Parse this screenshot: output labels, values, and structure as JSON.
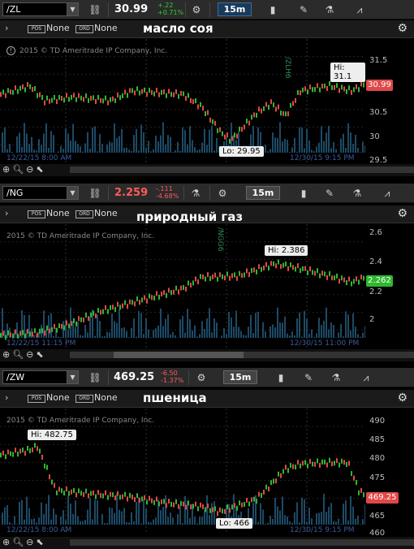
{
  "panels": [
    {
      "symbol": "/ZL",
      "price": "30.99",
      "price_color": "#ffffff",
      "chg1": "+.22",
      "chg2": "+0.71%",
      "chg_color": "#33cc33",
      "aggregation": "15m",
      "agg_blue": true,
      "pos_label": "POS",
      "pos_value": "None",
      "ord_label": "ORD",
      "ord_value": "None",
      "title": "масло соя",
      "copyright": "2015 © TD Ameritrade IP Company, Inc.",
      "ticks": [
        "31.5",
        "31",
        "30.5",
        "30",
        "29.5"
      ],
      "last_price": "30.99",
      "last_color": "#e04848",
      "hi": "Hi: 31.1",
      "lo": "Lo: 29.95",
      "date_left": "12/22/15 8:00 AM",
      "date_right": "12/30/15 9:15 PM",
      "contract": "/ZLH6"
    },
    {
      "symbol": "/NG",
      "price": "2.259",
      "price_color": "#ff5a5a",
      "chg1": "-.111",
      "chg2": "-4.68%",
      "chg_color": "#ff5a5a",
      "aggregation": "15m",
      "agg_blue": false,
      "pos_label": "POS",
      "pos_value": "None",
      "ord_label": "ORD",
      "ord_value": "None",
      "title": "природный газ",
      "copyright": "2015 © TD Ameritrade IP Company, Inc.",
      "ticks": [
        "2.6",
        "2.4",
        "2.2",
        "2"
      ],
      "last_price": "2.262",
      "last_color": "#2eb82e",
      "hi": "Hi: 2.386",
      "date_left": "12/22/15 11:15 PM",
      "date_right": "12/30/15 11:00 PM",
      "contract": "/NGG6"
    },
    {
      "symbol": "/ZW",
      "price": "469.25",
      "price_color": "#ffffff",
      "chg1": "-6.50",
      "chg2": "-1.37%",
      "chg_color": "#ff5a5a",
      "aggregation": "15m",
      "agg_blue": false,
      "pos_label": "POS",
      "pos_value": "None",
      "ord_label": "ORD",
      "ord_value": "None",
      "title": "пшеница",
      "copyright": "2015 © TD Ameritrade IP Company, Inc.",
      "ticks": [
        "490",
        "485",
        "480",
        "475",
        "470",
        "465",
        "460"
      ],
      "last_price": "469.25",
      "last_color": "#e04848",
      "hi": "Hi: 482.75",
      "lo": "Lo: 466",
      "date_left": "12/22/15 8:00 AM",
      "date_right": "12/30/15 9:15 PM"
    }
  ],
  "icons": {
    "link": "link-icon",
    "gear": "gear-icon",
    "candle": "candlestick-icon",
    "pencil": "drawing-icon",
    "flask": "studies-icon",
    "pattern": "pattern-icon"
  },
  "colors": {
    "up": "#2eb82e",
    "down": "#e04848",
    "volume": "#1d4a66",
    "grid": "#333333"
  }
}
